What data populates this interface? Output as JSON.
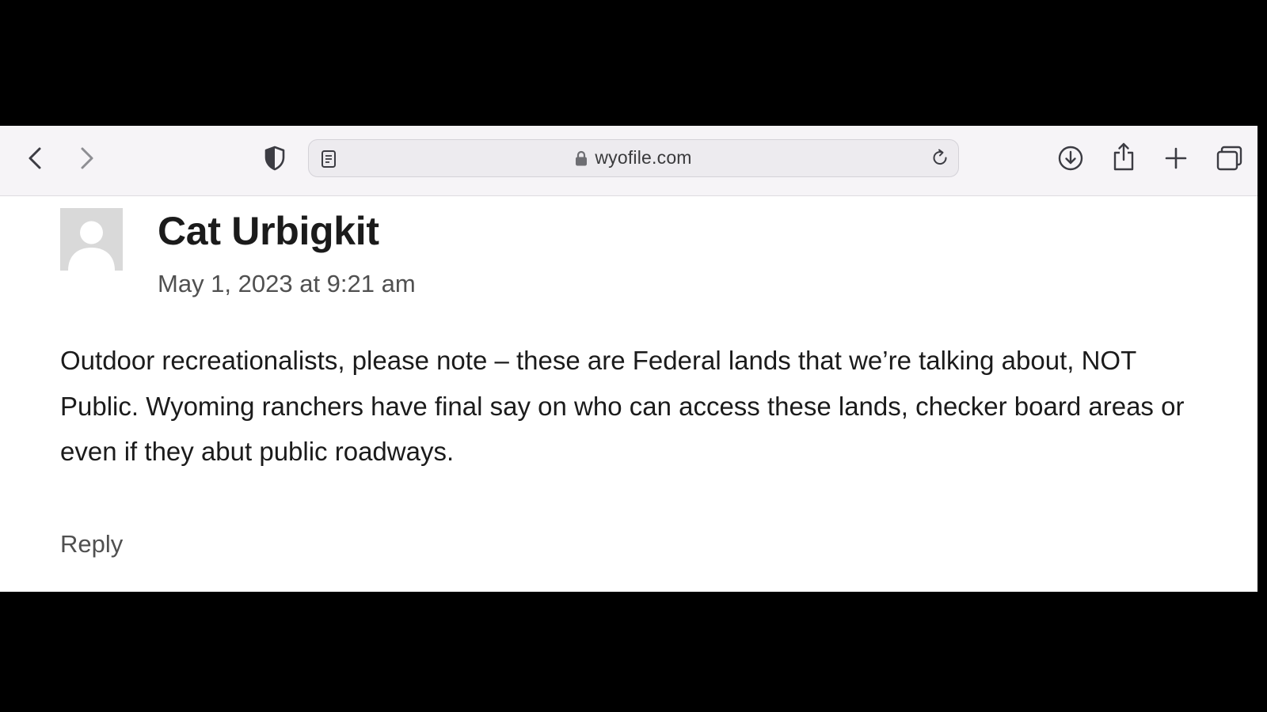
{
  "browser": {
    "url": "wyofile.com",
    "colors": {
      "toolbar_bg": "#f6f4f7",
      "icon": "#3c3c43",
      "icon_disabled": "#8e8e93"
    },
    "icons": [
      "back-icon",
      "forward-icon",
      "privacy-shield-icon",
      "reader-icon",
      "lock-icon",
      "reload-icon",
      "download-icon",
      "share-icon",
      "new-tab-icon",
      "tabs-overview-icon"
    ]
  },
  "comment": {
    "author": "Cat Urbigkit",
    "date": "May 1, 2023 at 9:21 am",
    "body": "Outdoor recreationalists, please note – these are Federal lands that we’re talking about, NOT Public. Wyoming ranchers have final say on who can access these lands, checker board areas or even if they abut public roadways.",
    "reply_label": "Reply"
  }
}
